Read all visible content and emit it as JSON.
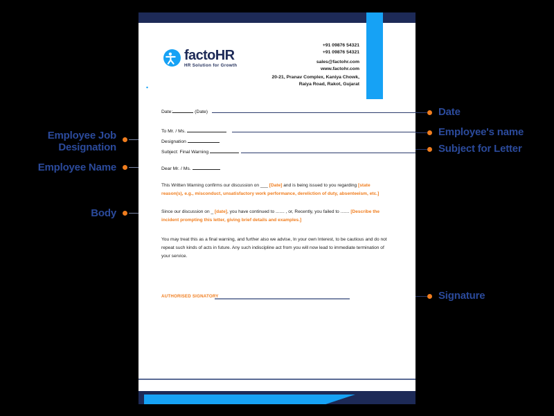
{
  "document": {
    "type": "letterhead-template",
    "brand": {
      "name": "factoHR",
      "tagline": "HR Solution for Growth"
    },
    "contact": {
      "phone_1": "+91 09876 54321",
      "phone_2": "+91 09876 54321",
      "email": "sales@factohr.com",
      "website": "www.factohr.com",
      "address_line_1": "20-21, Pranav Complex, Kaniya Chowk,",
      "address_line_2": "Raiya Road, Rakot, Gujarat"
    },
    "strip_icons": [
      {
        "name": "phone-icon",
        "glyph": "phone"
      },
      {
        "name": "globe-icon",
        "glyph": "globe"
      },
      {
        "name": "location-pin-icon",
        "glyph": "pin"
      }
    ],
    "fields": {
      "date_label": "Date:",
      "date_hint": "(Date)",
      "to_label": "To Mr. / Ms.",
      "designation_label": "Designation",
      "subject_label": "Subject: Final Warning",
      "salutation_label": "Dear Mr. / Ms."
    },
    "body": {
      "paragraph_1_part_1": "This Written Warning confirms our discussion on ___ ",
      "paragraph_1_highlight_1": "[Date]",
      "paragraph_1_part_2": " and is being issued to you regarding ",
      "paragraph_1_highlight_2": "[state reason(s), e.g., misconduct, unsatisfactory work performance, dereliction of duty, absenteeism, etc.]",
      "paragraph_2_part_1": "Since our discussion on _ ",
      "paragraph_2_highlight_1": "[date]",
      "paragraph_2_part_2": ", you have continued to ....... , or,  Recently, you failed to ....... ",
      "paragraph_2_highlight_2": "[Describe the incident prompting this letter, giving brief details and examples.]",
      "paragraph_3": "You may treat this as a final warning, and further also we advise, In your own Interest, to be cautious and do not repeat such kinds of acts in future.  Any such indiscipline act from you will now lead to immediate termination of your service."
    },
    "signature_label": "AUTHORISED SIGNATORY"
  },
  "annotations": {
    "left": [
      {
        "id": "employee-job-designation",
        "line_1": "Employee Job",
        "line_2": "Designation"
      },
      {
        "id": "employee-name",
        "line_1": "Employee Name",
        "line_2": ""
      },
      {
        "id": "body",
        "line_1": "Body",
        "line_2": ""
      }
    ],
    "right": [
      {
        "id": "date",
        "label": "Date"
      },
      {
        "id": "employees-name",
        "label": "Employee's name"
      },
      {
        "id": "subject-for-letter",
        "label": "Subject for Letter"
      },
      {
        "id": "signature",
        "label": "Signature"
      }
    ]
  },
  "colors": {
    "navy": "#1d2a57",
    "blue": "#16a2f5",
    "orange": "#f07d1e",
    "label_blue": "#2b4a9b",
    "connector": "#7c88a8",
    "background": "#000000",
    "paper": "#ffffff"
  }
}
